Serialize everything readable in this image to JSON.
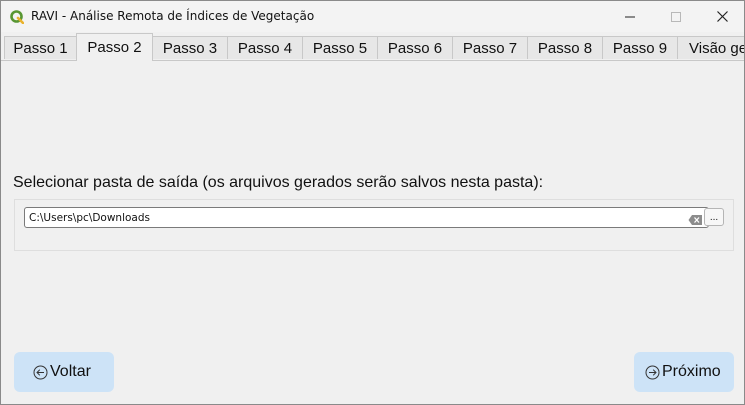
{
  "window": {
    "title": "RAVI - Análise Remota de Índices de Vegetação",
    "icon": "qgis-logo-icon"
  },
  "tabs": [
    {
      "label": "Passo 1",
      "active": false
    },
    {
      "label": "Passo 2",
      "active": true
    },
    {
      "label": "Passo 3",
      "active": false
    },
    {
      "label": "Passo 4",
      "active": false
    },
    {
      "label": "Passo 5",
      "active": false
    },
    {
      "label": "Passo 6",
      "active": false
    },
    {
      "label": "Passo 7",
      "active": false
    },
    {
      "label": "Passo 8",
      "active": false
    },
    {
      "label": "Passo 9",
      "active": false
    },
    {
      "label": "Visão ge",
      "active": false
    }
  ],
  "output": {
    "label": "Selecionar pasta de saída (os arquivos gerados serão salvos nesta pasta):",
    "path": "C:\\Users\\pc\\Downloads",
    "browse_label": "..."
  },
  "nav": {
    "back_label": "Voltar",
    "next_label": "Próximo"
  },
  "colors": {
    "nav_button_bg": "#cde3f7",
    "window_bg": "#f0f0f0",
    "qgis_green": "#589632"
  }
}
